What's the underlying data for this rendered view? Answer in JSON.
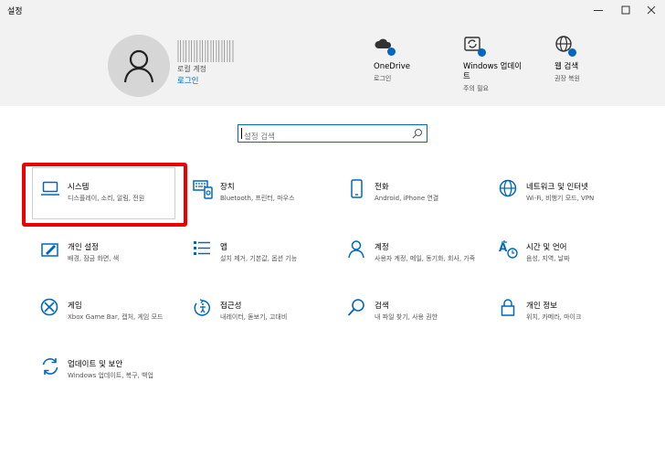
{
  "window": {
    "title": "설정"
  },
  "account": {
    "local_label": "로컬 계정",
    "signin_link": "로그인"
  },
  "header_items": [
    {
      "title": "OneDrive",
      "subtitle": "로그인",
      "icon": "onedrive-cloud-icon"
    },
    {
      "title": "Windows 업데이트",
      "subtitle": "주의 필요",
      "icon": "windows-update-icon"
    },
    {
      "title": "웹 검색",
      "subtitle": "권장 복원",
      "icon": "globe-icon"
    }
  ],
  "search": {
    "placeholder": "설정 검색"
  },
  "tiles": [
    {
      "title": "시스템",
      "desc": "디스플레이, 소리, 알림, 전원",
      "icon": "laptop-icon"
    },
    {
      "title": "장치",
      "desc": "Bluetooth, 프린터, 마우스",
      "icon": "devices-icon"
    },
    {
      "title": "전화",
      "desc": "Android, iPhone 연결",
      "icon": "phone-icon"
    },
    {
      "title": "네트워크 및 인터넷",
      "desc": "Wi-Fi, 비행기 모드, VPN",
      "icon": "globe-icon"
    },
    {
      "title": "개인 설정",
      "desc": "배경, 잠금 화면, 색",
      "icon": "paint-icon"
    },
    {
      "title": "앱",
      "desc": "설치 제거, 기본값, 옵션 기능",
      "icon": "apps-list-icon"
    },
    {
      "title": "계정",
      "desc": "사용자 계정, 메일, 동기화, 회사, 가족",
      "icon": "person-icon"
    },
    {
      "title": "시간 및 언어",
      "desc": "음성, 지역, 날짜",
      "icon": "time-language-icon"
    },
    {
      "title": "게임",
      "desc": "Xbox Game Bar, 캡처, 게임 모드",
      "icon": "xbox-icon"
    },
    {
      "title": "접근성",
      "desc": "내레이터, 돋보기, 고대비",
      "icon": "accessibility-icon"
    },
    {
      "title": "검색",
      "desc": "내 파일 찾기, 사용 권한",
      "icon": "search-icon"
    },
    {
      "title": "개인 정보",
      "desc": "위치, 카메라, 마이크",
      "icon": "lock-icon"
    },
    {
      "title": "업데이트 및 보안",
      "desc": "Windows 업데이트, 복구, 백업",
      "icon": "update-sync-icon"
    }
  ],
  "colors": {
    "accent": "#0067c0",
    "highlight": "#ee0000",
    "header_bg": "#f2f2f2"
  }
}
